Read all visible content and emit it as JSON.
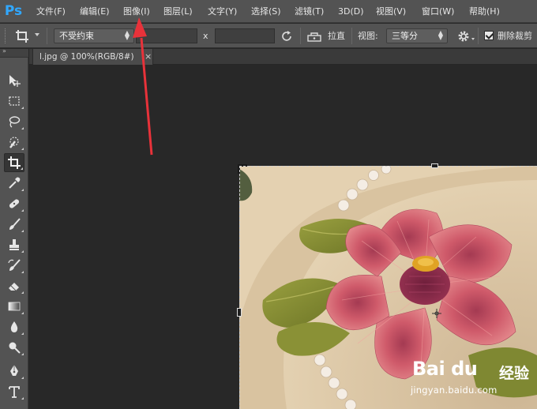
{
  "app": {
    "logo": "Ps"
  },
  "menu": [
    {
      "label": "文件(F)"
    },
    {
      "label": "编辑(E)"
    },
    {
      "label": "图像(I)"
    },
    {
      "label": "图层(L)"
    },
    {
      "label": "文字(Y)"
    },
    {
      "label": "选择(S)"
    },
    {
      "label": "滤镜(T)"
    },
    {
      "label": "3D(D)"
    },
    {
      "label": "视图(V)"
    },
    {
      "label": "窗口(W)"
    },
    {
      "label": "帮助(H)"
    }
  ],
  "options": {
    "ratio_select": "不受约束",
    "width_value": "",
    "x_label": "x",
    "height_value": "",
    "straighten_label": "拉直",
    "view_label": "视图:",
    "view_select": "三等分",
    "delete_cropped_label": "删除裁剪",
    "delete_cropped_checked": true
  },
  "toolbar": {
    "collapse_glyph": "»",
    "tools": [
      {
        "icon": "move-icon"
      },
      {
        "icon": "rect-marquee-icon"
      },
      {
        "icon": "lasso-icon"
      },
      {
        "icon": "quick-select-icon"
      },
      {
        "icon": "crop-icon",
        "active": true
      },
      {
        "icon": "eyedropper-icon"
      },
      {
        "icon": "healing-brush-icon"
      },
      {
        "icon": "brush-icon"
      },
      {
        "icon": "clone-stamp-icon"
      },
      {
        "icon": "history-brush-icon"
      },
      {
        "icon": "eraser-icon"
      },
      {
        "icon": "gradient-icon"
      },
      {
        "icon": "blur-icon"
      },
      {
        "icon": "dodge-icon"
      },
      {
        "icon": "pen-icon"
      },
      {
        "icon": "type-icon"
      }
    ]
  },
  "document": {
    "tab_title": "l.jpg @ 100%(RGB/8#)",
    "close_glyph": "×"
  },
  "watermark": {
    "logo": "Bai du",
    "suffix": "经验",
    "url": "jingyan.baidu.com"
  },
  "colors": {
    "ps_blue": "#31a8ff",
    "annotation_red": "#e8323a",
    "panel": "#535353",
    "workspace": "#282828"
  }
}
